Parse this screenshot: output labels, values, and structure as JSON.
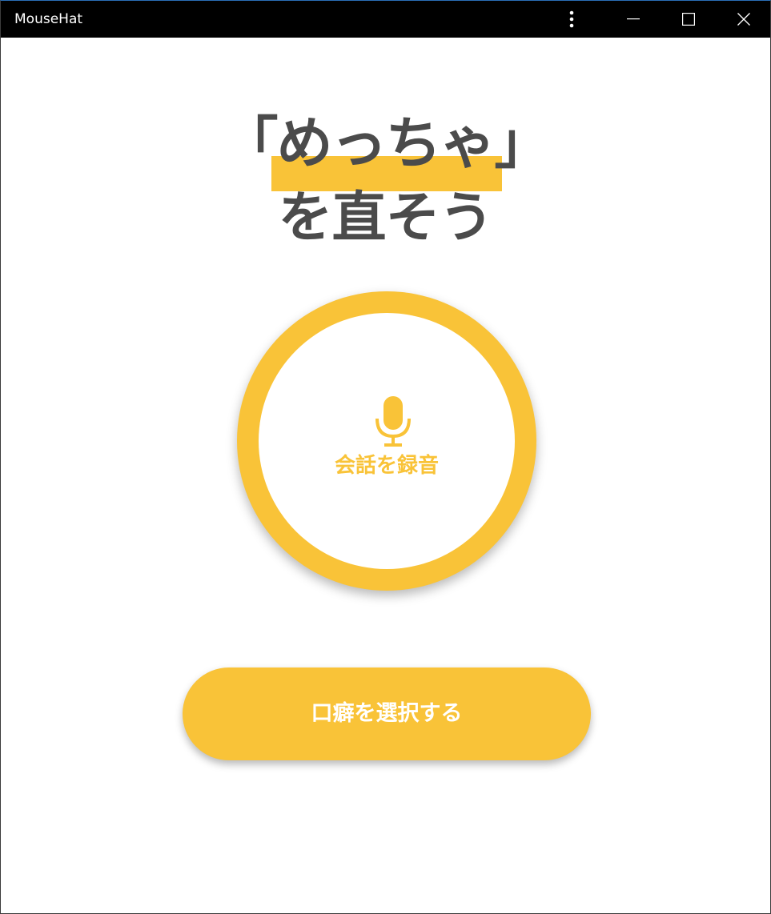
{
  "window": {
    "title": "MouseHat",
    "controls": {
      "more": "more-options-icon",
      "minimize": "minimize-icon",
      "maximize": "maximize-icon",
      "close": "close-icon"
    }
  },
  "headline": {
    "line1": "「めっちゃ」",
    "line2": "を直そう"
  },
  "record_button": {
    "icon": "microphone-icon",
    "label": "会話を録音"
  },
  "select_button": {
    "label": "口癖を選択する"
  },
  "colors": {
    "accent": "#f9c338",
    "text": "#4b4b4b",
    "titlebar": "#000000"
  }
}
